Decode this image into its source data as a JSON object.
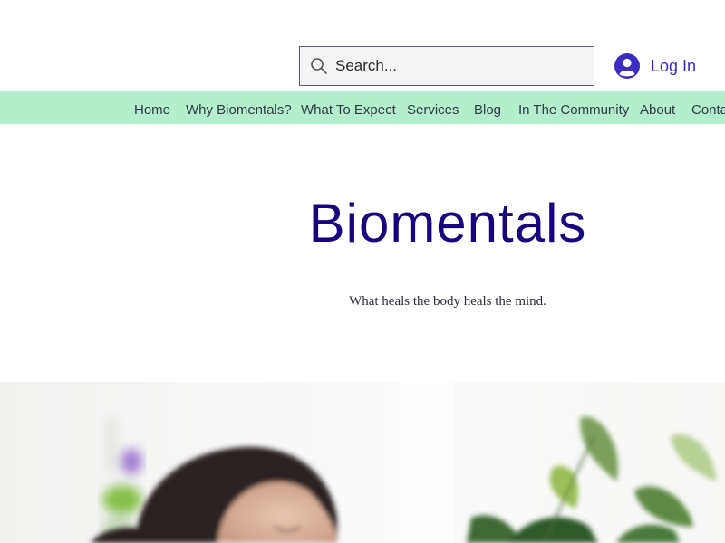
{
  "search": {
    "placeholder": "Search..."
  },
  "login": {
    "label": "Log In"
  },
  "nav": {
    "items": [
      "Home",
      "Why Biomentals?",
      "What To Expect",
      "Services",
      "Blog",
      "In The Community",
      "About",
      "Contact"
    ]
  },
  "hero": {
    "title": "Biomentals",
    "tagline": "What heals the body heals the mind."
  },
  "colors": {
    "nav_background": "#b4efcd",
    "brand": "#18047e",
    "login_accent": "#3b2cc1"
  },
  "icons": {
    "search": "search-icon",
    "avatar": "avatar-icon"
  }
}
